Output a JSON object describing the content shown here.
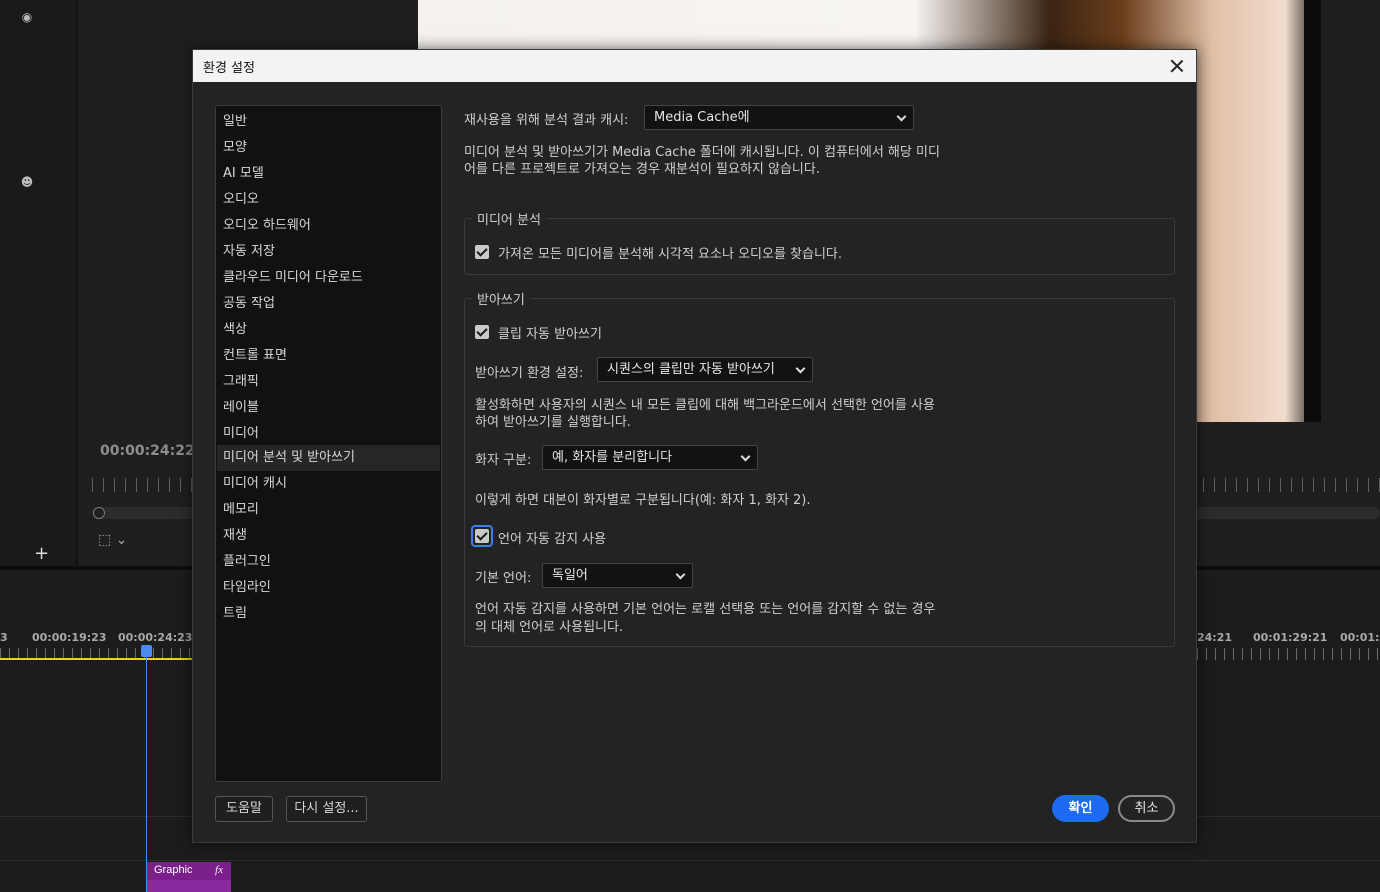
{
  "background": {
    "monitor_timecode": "00:00:24:22",
    "timeline_times": [
      "3",
      "00:00:19:23",
      "00:00:24:23",
      "24:21",
      "00:01:29:21",
      "00:01:3"
    ],
    "clip_label": "Graphic",
    "clip_fx": "fx",
    "add_button": "+"
  },
  "dialog": {
    "title": "환경 설정",
    "sidebar": [
      "일반",
      "모양",
      "AI 모델",
      "오디오",
      "오디오 하드웨어",
      "자동 저장",
      "클라우드 미디어 다운로드",
      "공동 작업",
      "색상",
      "컨트롤 표면",
      "그래픽",
      "레이블",
      "미디어",
      "미디어 분석 및 받아쓰기",
      "미디어 캐시",
      "메모리",
      "재생",
      "플러그인",
      "타임라인",
      "트림"
    ],
    "active_item": "미디어 분석 및 받아쓰기",
    "cache_label": "재사용을 위해 분석 결과 캐시:",
    "cache_value": "Media Cache에",
    "cache_desc_1": "미디어 분석 및 받아쓰기가 Media Cache 폴더에 캐시됩니다. 이 컴퓨터에서 해당 미디",
    "cache_desc_2": "어를 다른 프로젝트로 가져오는 경우 재분석이 필요하지 않습니다.",
    "analysis": {
      "legend": "미디어 분석",
      "checkbox_label": "가져온 모든 미디어를 분석해 시각적 요소나 오디오를 찾습니다.",
      "checked": true
    },
    "transcription": {
      "legend": "받아쓰기",
      "auto_label": "클립 자동 받아쓰기",
      "auto_checked": true,
      "pref_label": "받아쓰기 환경 설정:",
      "pref_value": "시퀀스의 클립만 자동 받아쓰기",
      "pref_desc_1": "활성화하면 사용자의 시퀀스 내 모든 클립에 대해 백그라운드에서 선택한 언어를 사용",
      "pref_desc_2": "하여 받아쓰기를 실행합니다.",
      "speaker_label": "화자 구분:",
      "speaker_value": "예, 화자를 분리합니다",
      "speaker_desc": "이렇게 하면 대본이 화자별로 구분됩니다(예: 화자 1, 화자 2).",
      "lang_auto_label": "언어 자동 감지 사용",
      "lang_auto_checked": true,
      "default_lang_label": "기본 언어:",
      "default_lang_value": "독일어",
      "lang_desc_1": "언어 자동 감지를 사용하면 기본 언어는 로캘 선택용 또는 언어를 감지할 수 없는 경우",
      "lang_desc_2": "의 대체 언어로 사용됩니다."
    },
    "buttons": {
      "help": "도움말",
      "reset": "다시 설정...",
      "ok": "확인",
      "cancel": "취소"
    }
  }
}
